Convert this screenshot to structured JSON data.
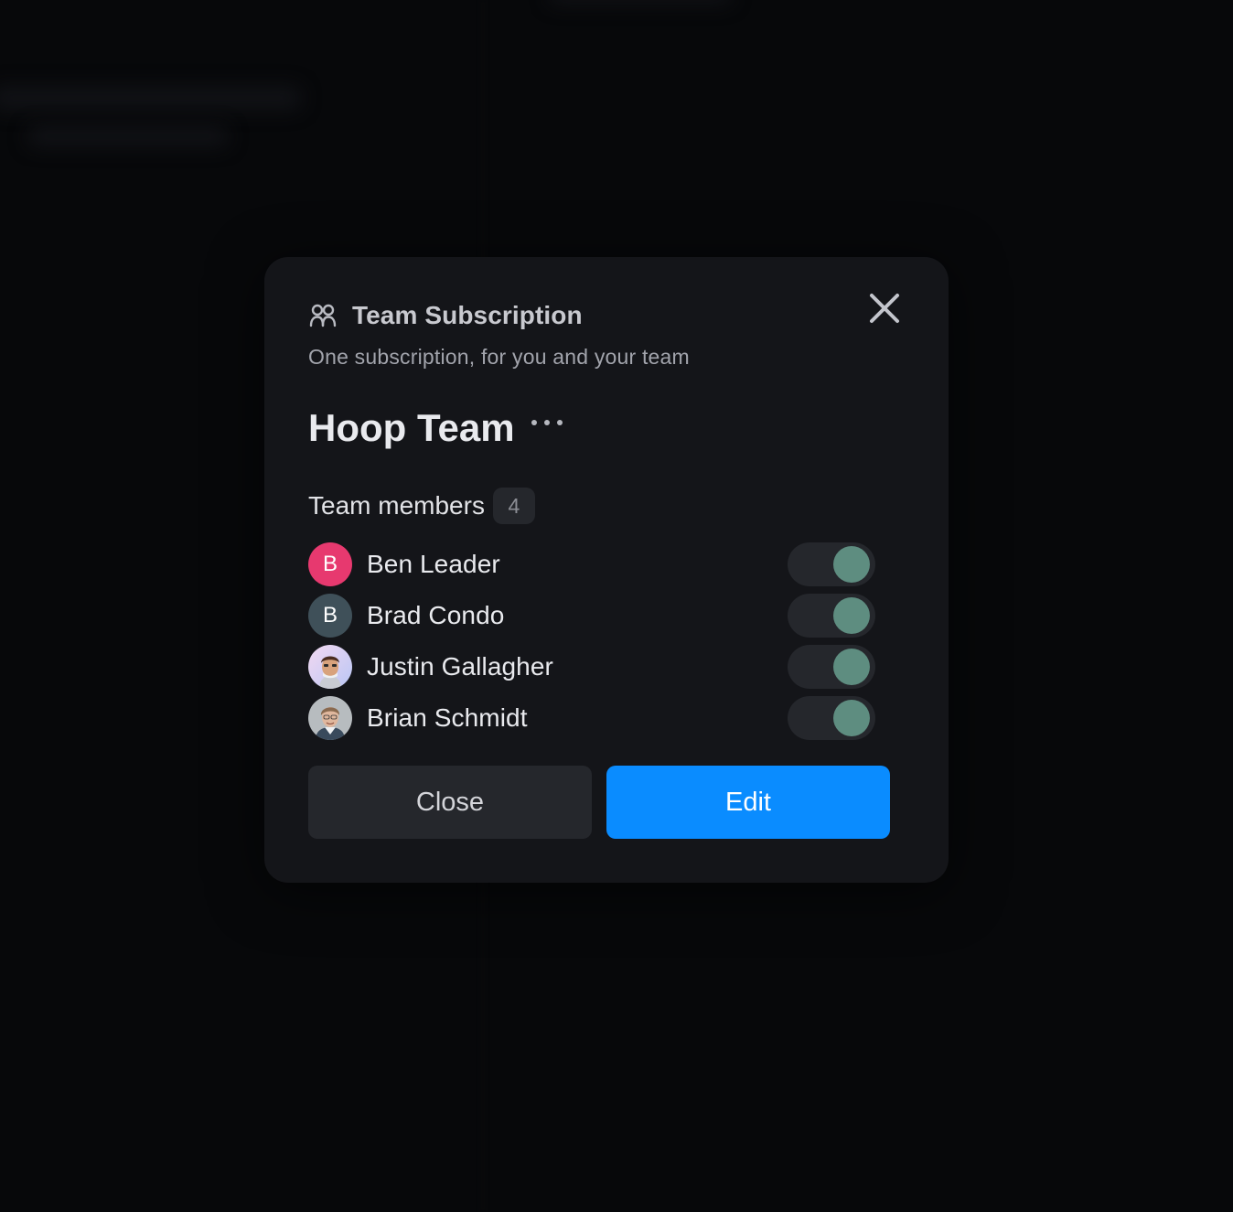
{
  "modal": {
    "header_title": "Team Subscription",
    "subtitle": "One subscription, for you and your team",
    "team_name": "Hoop Team",
    "members_label": "Team members",
    "members_count": "4",
    "close_button_label": "Close",
    "edit_button_label": "Edit"
  },
  "members": [
    {
      "name": "Ben Leader",
      "initial": "B",
      "avatar_color": "#e7396f",
      "enabled": true
    },
    {
      "name": "Brad Condo",
      "initial": "B",
      "avatar_color": "#3f5059",
      "enabled": true
    },
    {
      "name": "Justin Gallagher",
      "initial": "",
      "avatar_color": "#c9c3f2",
      "enabled": true
    },
    {
      "name": "Brian Schmidt",
      "initial": "",
      "avatar_color": "#9aa2a6",
      "enabled": true
    }
  ],
  "icons": {
    "header": "team-icon",
    "close": "close-icon",
    "more": "more-horizontal-icon"
  },
  "colors": {
    "accent": "#0a8cff",
    "toggle_on": "#5e8d80",
    "modal_bg": "#141519"
  }
}
